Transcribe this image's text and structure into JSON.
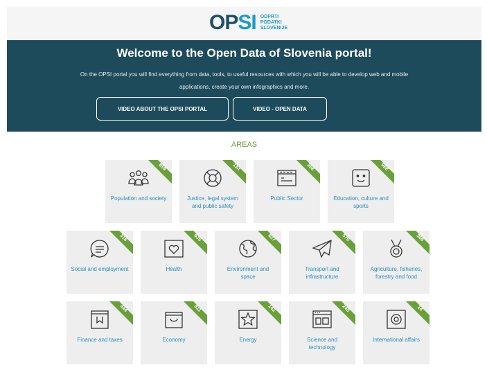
{
  "header": {
    "logo_main_a": "OP",
    "logo_main_b": "SI",
    "logo_sub": [
      "ODPRTI",
      "PODATKI",
      "SLOVENIJE"
    ]
  },
  "hero": {
    "title": "Welcome to the Open Data of Slovenia portal!",
    "description_line1": "On the OPSI portal you will find everything from data, tools, to useful resources with which you will be able to develop web and mobile",
    "description_line2": "applications, create your own infographics and more.",
    "button_video_portal": "VIDEO ABOUT THE OPSI PORTAL",
    "button_video_opendata": "VIDEO - OPEN DATA"
  },
  "areas": {
    "title": "AREAS",
    "colors": {
      "label": "#2a8fc4",
      "badge": "#6aa03a",
      "tile": "#eeeeee"
    },
    "tiles": [
      {
        "label": "Population and society",
        "count": "859",
        "icon": "people-icon"
      },
      {
        "label": "Justice, legal system and public safety",
        "count": "134",
        "icon": "lifebuoy-icon"
      },
      {
        "label": "Public Sector",
        "count": "358",
        "icon": "building-icon"
      },
      {
        "label": "Education, culture and sports",
        "count": "988",
        "icon": "smiley-icon"
      },
      {
        "label": "Social and employment",
        "count": "316",
        "icon": "chat-icon"
      },
      {
        "label": "Health",
        "count": "635",
        "icon": "heart-icon"
      },
      {
        "label": "Environment and space",
        "count": "827",
        "icon": "globe-icon"
      },
      {
        "label": "Transport and infrastructure",
        "count": "570",
        "icon": "paper-plane-icon"
      },
      {
        "label": "Agriculture, fisheries, forestry and food",
        "count": "366",
        "icon": "medal-icon"
      },
      {
        "label": "Finance and taxes",
        "count": "444",
        "icon": "wallet-icon"
      },
      {
        "label": "Economy",
        "count": "811",
        "icon": "bag-icon"
      },
      {
        "label": "Energy",
        "count": "142",
        "icon": "star-icon"
      },
      {
        "label": "Science and technology",
        "count": "248",
        "icon": "window-icon"
      },
      {
        "label": "International affairs",
        "count": "14",
        "icon": "target-icon"
      }
    ]
  }
}
